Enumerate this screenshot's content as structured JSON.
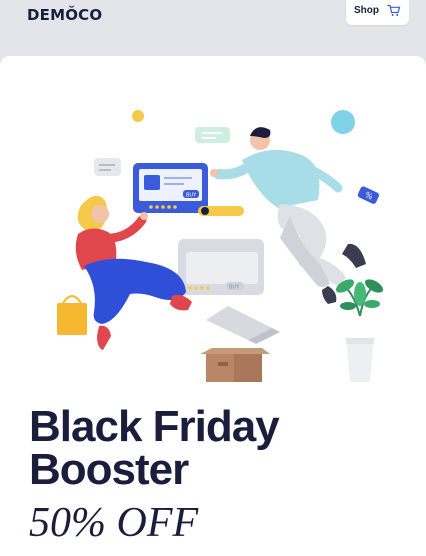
{
  "header": {
    "logo": "DEMŎCO",
    "shop_label": "Shop",
    "cart_icon": "cart-icon"
  },
  "hero": {
    "illustration": "online-shopping-illustration",
    "card_button_label": "BUY",
    "card2_button_label": "BUY",
    "tag_label": "%"
  },
  "headline": {
    "line1": "Black Friday",
    "line2": "Booster",
    "discount": "50% OFF"
  },
  "colors": {
    "text": "#1b1d3c",
    "background": "#e4e5ea",
    "card": "#ffffff",
    "accent_blue": "#3b5bdb",
    "accent_yellow": "#f5c94a",
    "accent_red": "#e0474c"
  }
}
